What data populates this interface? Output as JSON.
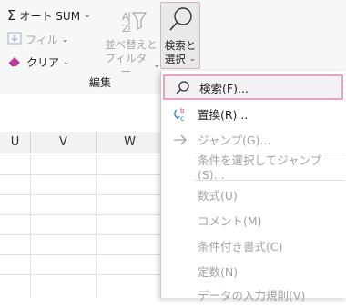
{
  "ribbon": {
    "autosum_label": "オート SUM",
    "fill_label": "フィル",
    "clear_label": "クリア",
    "sort_filter_line1": "並べ替えと",
    "sort_filter_line2": "フィルター",
    "find_select_line1": "検索と",
    "find_select_line2": "選択",
    "group_label": "編集"
  },
  "sheet": {
    "columns": [
      "U",
      "V",
      "W"
    ]
  },
  "menu": {
    "items": [
      {
        "label": "検索(F)...",
        "icon": "search-icon",
        "enabled": true,
        "highlighted": true
      },
      {
        "label": "置換(R)...",
        "icon": "replace-icon",
        "enabled": true
      },
      {
        "label": "ジャンプ(G)...",
        "icon": "arrow-right-icon",
        "enabled": false
      },
      {
        "label": "条件を選択してジャンプ(S)...",
        "enabled": false
      },
      {
        "label": "数式(U)",
        "enabled": false
      },
      {
        "label": "コメント(M)",
        "enabled": false
      },
      {
        "label": "条件付き書式(C)",
        "enabled": false
      },
      {
        "label": "定数(N)",
        "enabled": false
      },
      {
        "label": "データの入力規則(V)",
        "enabled": false
      }
    ]
  },
  "colors": {
    "highlight_border": "#eaa3bf",
    "disabled_text": "#a3a3a3",
    "clear_icon": "#c0399a",
    "replace_icon": "#2b7cd3"
  }
}
